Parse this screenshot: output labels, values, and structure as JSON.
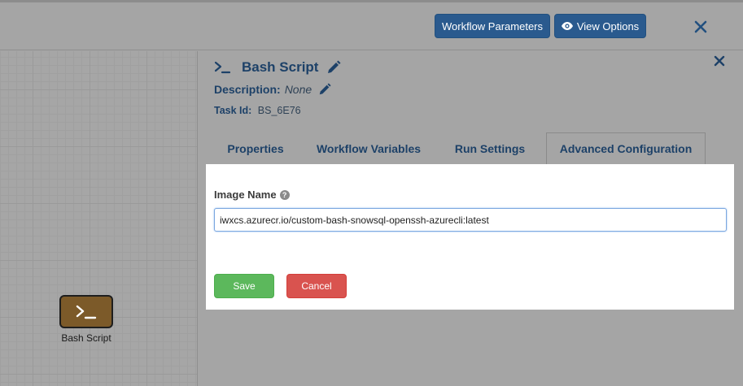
{
  "header": {
    "workflow_parameters_label": "Workflow Parameters",
    "view_options_label": "View Options",
    "close_icon": "close-icon"
  },
  "canvas": {
    "node": {
      "label": "Bash Script",
      "icon": "terminal-icon",
      "color": "#7c5a29"
    }
  },
  "panel": {
    "title": "Bash Script",
    "description_label": "Description:",
    "description_value": "None",
    "task_id_label": "Task Id:",
    "task_id_value": "BS_6E76",
    "tabs": [
      {
        "label": "Properties",
        "active": false
      },
      {
        "label": "Workflow Variables",
        "active": false
      },
      {
        "label": "Run Settings",
        "active": false
      },
      {
        "label": "Advanced Configuration",
        "active": true
      }
    ],
    "form": {
      "image_name_label": "Image Name",
      "image_name_value": "iwxcs.azurecr.io/custom-bash-snowsql-openssh-azurecli:latest",
      "save_label": "Save",
      "cancel_label": "Cancel"
    }
  },
  "colors": {
    "primary_button": "#2a5a8e",
    "heading_text": "#1d4168",
    "save_button": "#5cb85c",
    "cancel_button": "#d9534f"
  }
}
